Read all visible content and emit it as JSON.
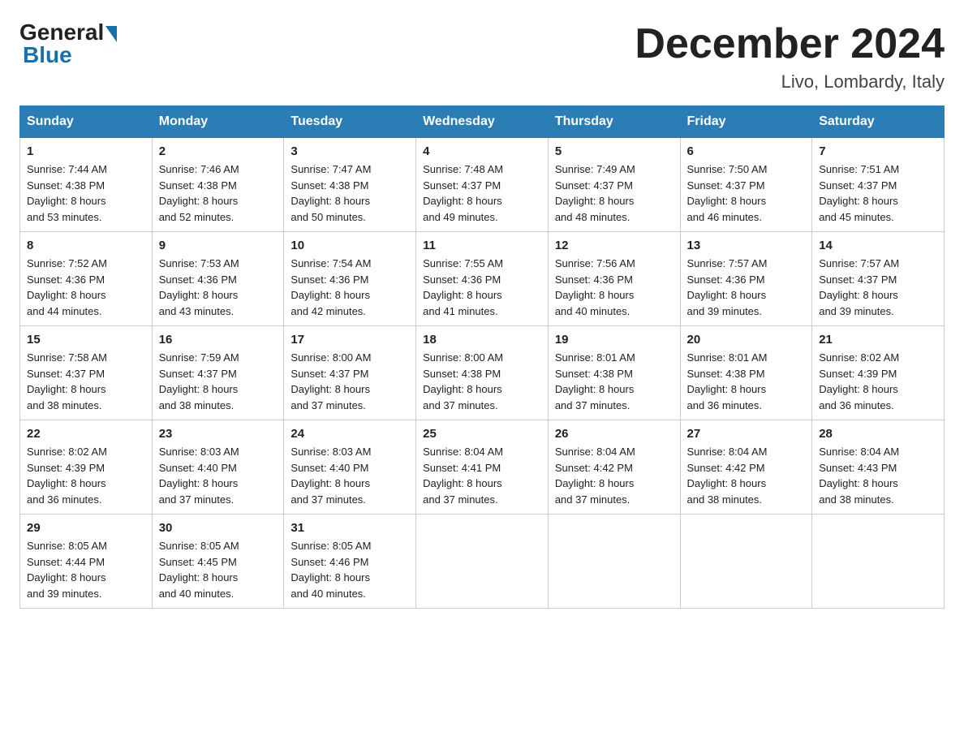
{
  "logo": {
    "general": "General",
    "blue": "Blue"
  },
  "title": "December 2024",
  "location": "Livo, Lombardy, Italy",
  "weekdays": [
    "Sunday",
    "Monday",
    "Tuesday",
    "Wednesday",
    "Thursday",
    "Friday",
    "Saturday"
  ],
  "weeks": [
    [
      {
        "day": "1",
        "sunrise": "7:44 AM",
        "sunset": "4:38 PM",
        "daylight": "8 hours and 53 minutes."
      },
      {
        "day": "2",
        "sunrise": "7:46 AM",
        "sunset": "4:38 PM",
        "daylight": "8 hours and 52 minutes."
      },
      {
        "day": "3",
        "sunrise": "7:47 AM",
        "sunset": "4:38 PM",
        "daylight": "8 hours and 50 minutes."
      },
      {
        "day": "4",
        "sunrise": "7:48 AM",
        "sunset": "4:37 PM",
        "daylight": "8 hours and 49 minutes."
      },
      {
        "day": "5",
        "sunrise": "7:49 AM",
        "sunset": "4:37 PM",
        "daylight": "8 hours and 48 minutes."
      },
      {
        "day": "6",
        "sunrise": "7:50 AM",
        "sunset": "4:37 PM",
        "daylight": "8 hours and 46 minutes."
      },
      {
        "day": "7",
        "sunrise": "7:51 AM",
        "sunset": "4:37 PM",
        "daylight": "8 hours and 45 minutes."
      }
    ],
    [
      {
        "day": "8",
        "sunrise": "7:52 AM",
        "sunset": "4:36 PM",
        "daylight": "8 hours and 44 minutes."
      },
      {
        "day": "9",
        "sunrise": "7:53 AM",
        "sunset": "4:36 PM",
        "daylight": "8 hours and 43 minutes."
      },
      {
        "day": "10",
        "sunrise": "7:54 AM",
        "sunset": "4:36 PM",
        "daylight": "8 hours and 42 minutes."
      },
      {
        "day": "11",
        "sunrise": "7:55 AM",
        "sunset": "4:36 PM",
        "daylight": "8 hours and 41 minutes."
      },
      {
        "day": "12",
        "sunrise": "7:56 AM",
        "sunset": "4:36 PM",
        "daylight": "8 hours and 40 minutes."
      },
      {
        "day": "13",
        "sunrise": "7:57 AM",
        "sunset": "4:36 PM",
        "daylight": "8 hours and 39 minutes."
      },
      {
        "day": "14",
        "sunrise": "7:57 AM",
        "sunset": "4:37 PM",
        "daylight": "8 hours and 39 minutes."
      }
    ],
    [
      {
        "day": "15",
        "sunrise": "7:58 AM",
        "sunset": "4:37 PM",
        "daylight": "8 hours and 38 minutes."
      },
      {
        "day": "16",
        "sunrise": "7:59 AM",
        "sunset": "4:37 PM",
        "daylight": "8 hours and 38 minutes."
      },
      {
        "day": "17",
        "sunrise": "8:00 AM",
        "sunset": "4:37 PM",
        "daylight": "8 hours and 37 minutes."
      },
      {
        "day": "18",
        "sunrise": "8:00 AM",
        "sunset": "4:38 PM",
        "daylight": "8 hours and 37 minutes."
      },
      {
        "day": "19",
        "sunrise": "8:01 AM",
        "sunset": "4:38 PM",
        "daylight": "8 hours and 37 minutes."
      },
      {
        "day": "20",
        "sunrise": "8:01 AM",
        "sunset": "4:38 PM",
        "daylight": "8 hours and 36 minutes."
      },
      {
        "day": "21",
        "sunrise": "8:02 AM",
        "sunset": "4:39 PM",
        "daylight": "8 hours and 36 minutes."
      }
    ],
    [
      {
        "day": "22",
        "sunrise": "8:02 AM",
        "sunset": "4:39 PM",
        "daylight": "8 hours and 36 minutes."
      },
      {
        "day": "23",
        "sunrise": "8:03 AM",
        "sunset": "4:40 PM",
        "daylight": "8 hours and 37 minutes."
      },
      {
        "day": "24",
        "sunrise": "8:03 AM",
        "sunset": "4:40 PM",
        "daylight": "8 hours and 37 minutes."
      },
      {
        "day": "25",
        "sunrise": "8:04 AM",
        "sunset": "4:41 PM",
        "daylight": "8 hours and 37 minutes."
      },
      {
        "day": "26",
        "sunrise": "8:04 AM",
        "sunset": "4:42 PM",
        "daylight": "8 hours and 37 minutes."
      },
      {
        "day": "27",
        "sunrise": "8:04 AM",
        "sunset": "4:42 PM",
        "daylight": "8 hours and 38 minutes."
      },
      {
        "day": "28",
        "sunrise": "8:04 AM",
        "sunset": "4:43 PM",
        "daylight": "8 hours and 38 minutes."
      }
    ],
    [
      {
        "day": "29",
        "sunrise": "8:05 AM",
        "sunset": "4:44 PM",
        "daylight": "8 hours and 39 minutes."
      },
      {
        "day": "30",
        "sunrise": "8:05 AM",
        "sunset": "4:45 PM",
        "daylight": "8 hours and 40 minutes."
      },
      {
        "day": "31",
        "sunrise": "8:05 AM",
        "sunset": "4:46 PM",
        "daylight": "8 hours and 40 minutes."
      },
      null,
      null,
      null,
      null
    ]
  ]
}
